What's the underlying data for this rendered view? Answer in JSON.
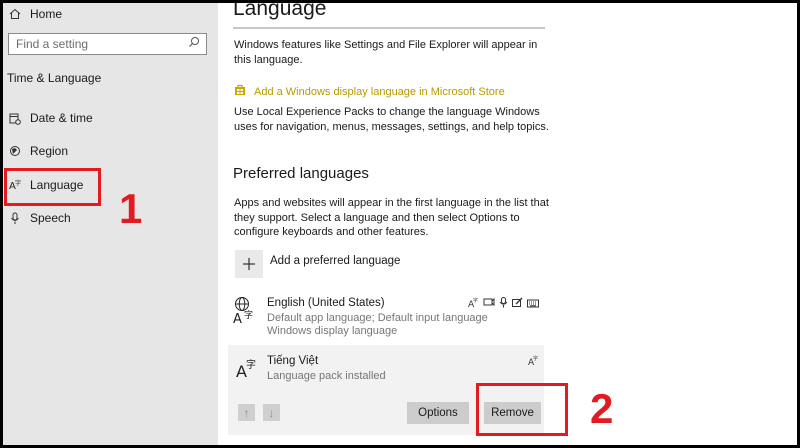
{
  "sidebar": {
    "home_label": "Home",
    "search_placeholder": "Find a setting",
    "section_title": "Time & Language",
    "items": [
      {
        "label": "Date & time",
        "icon": "calendar-clock-icon"
      },
      {
        "label": "Region",
        "icon": "globe-region-icon"
      },
      {
        "label": "Language",
        "icon": "language-icon",
        "selected": true
      },
      {
        "label": "Speech",
        "icon": "microphone-icon"
      }
    ]
  },
  "main": {
    "title": "Language",
    "intro": "Windows features like Settings and File Explorer will appear in this language.",
    "store_link": "Add a Windows display language in Microsoft Store",
    "store_desc": "Use Local Experience Packs to change the language Windows uses for navigation, menus, messages, settings, and help topics.",
    "preferred_title": "Preferred languages",
    "preferred_desc": "Apps and websites will appear in the first language in the list that they support. Select a language and then select Options to configure keyboards and other features.",
    "add_label": "Add a preferred language",
    "languages": [
      {
        "name": "English (United States)",
        "details": [
          "Default app language; Default input language",
          "Windows display language"
        ],
        "feature_icons": [
          "language-pack-icon",
          "speech-icon",
          "microphone-icon",
          "handwriting-icon",
          "keyboard-icon"
        ]
      },
      {
        "name": "Tiếng Việt",
        "details": [
          "Language pack installed"
        ],
        "feature_icons": [
          "language-pack-icon"
        ]
      }
    ],
    "move_up": "↑",
    "move_down": "↓",
    "options_label": "Options",
    "remove_label": "Remove"
  },
  "annotations": {
    "step1": "1",
    "step2": "2",
    "color": "#e21b22"
  },
  "colors": {
    "sidebar_bg": "#e6e6e6",
    "store_link": "#b89a00",
    "button_bg": "#cccccc"
  }
}
